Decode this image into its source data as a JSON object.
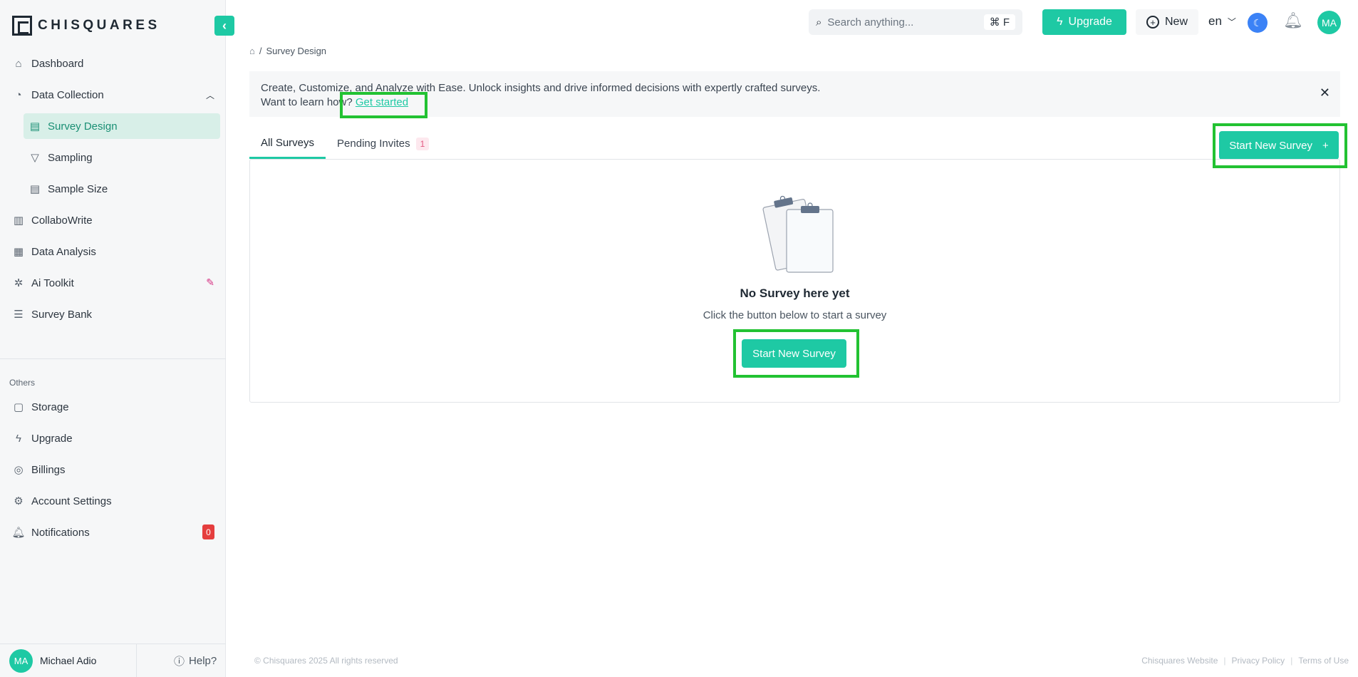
{
  "brand": {
    "name": "CHISQUARES"
  },
  "sidebar": {
    "items": [
      {
        "label": "Dashboard",
        "icon": "home-icon"
      },
      {
        "label": "Data Collection",
        "icon": "palette-icon"
      },
      {
        "label": "Survey Design",
        "icon": "clipboard-icon"
      },
      {
        "label": "Sampling",
        "icon": "filter-icon"
      },
      {
        "label": "Sample Size",
        "icon": "clipboard-icon"
      },
      {
        "label": "CollaboWrite",
        "icon": "chart-icon"
      },
      {
        "label": "Data Analysis",
        "icon": "table-icon"
      },
      {
        "label": "Ai Toolkit",
        "icon": "sparkle-icon"
      },
      {
        "label": "Survey Bank",
        "icon": "list-icon"
      }
    ],
    "others_label": "Others",
    "others": [
      {
        "label": "Storage",
        "icon": "folder-icon"
      },
      {
        "label": "Upgrade",
        "icon": "bolt-icon"
      },
      {
        "label": "Billings",
        "icon": "coin-icon"
      },
      {
        "label": "Account Settings",
        "icon": "gear-icon"
      },
      {
        "label": "Notifications",
        "icon": "bell-icon",
        "badge": "0"
      }
    ],
    "user": {
      "initials": "MA",
      "name": "Michael Adio"
    },
    "help_label": "Help?"
  },
  "topbar": {
    "search_placeholder": "Search anything...",
    "shortcut": "⌘ F",
    "upgrade_label": "Upgrade",
    "new_label": "New",
    "language": "en",
    "avatar_initials": "MA"
  },
  "breadcrumb": {
    "separator": "/",
    "current": "Survey Design"
  },
  "banner": {
    "line1": "Create, Customize, and Analyze with Ease. Unlock insights and drive informed decisions with expertly crafted surveys.",
    "line2_prefix": "Want to learn how?",
    "link_label": "Get started"
  },
  "tabs": [
    {
      "label": "All Surveys"
    },
    {
      "label": "Pending Invites",
      "badge": "1"
    }
  ],
  "actions": {
    "start_new_survey": "Start New Survey"
  },
  "empty_state": {
    "title": "No Survey here yet",
    "subtitle": "Click the button below to start a survey",
    "button_label": "Start New Survey"
  },
  "footer": {
    "copyright": "© Chisquares 2025 All rights reserved",
    "links": [
      "Chisquares Website",
      "Privacy Policy",
      "Terms of Use"
    ]
  },
  "colors": {
    "accent": "#1ec9a4",
    "highlight": "#22c232",
    "badge_red": "#e53e3e"
  }
}
